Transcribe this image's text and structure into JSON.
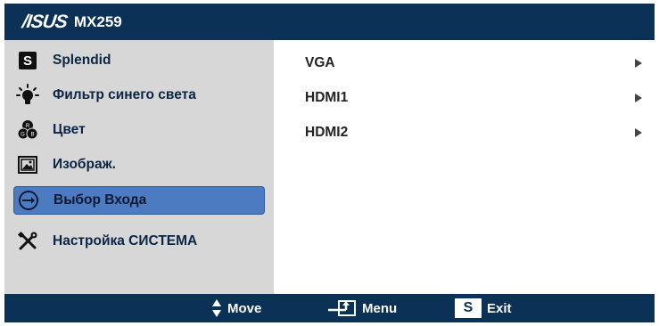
{
  "header": {
    "brand": "/ISUS",
    "model": "MX259"
  },
  "sidebar": {
    "items": [
      {
        "label": "Splendid",
        "icon": "splendid-s-icon"
      },
      {
        "label": "Фильтр синего света",
        "icon": "bulb-icon"
      },
      {
        "label": "Цвет",
        "icon": "rgb-icon"
      },
      {
        "label": "Изображ.",
        "icon": "image-icon"
      },
      {
        "label": "Выбор Входа",
        "icon": "input-select-icon",
        "selected": true
      },
      {
        "label": "Настройка СИСТЕМА",
        "icon": "tools-icon"
      }
    ]
  },
  "content": {
    "options": [
      {
        "label": "VGA"
      },
      {
        "label": "HDMI1"
      },
      {
        "label": "HDMI2"
      }
    ]
  },
  "footer": {
    "move_label": "Move",
    "menu_label": "Menu",
    "exit_label": "Exit",
    "exit_key": "S"
  },
  "colors": {
    "bar": "#0b3157",
    "sidebar": "#d7d7d7",
    "selected": "#4d7bc2"
  }
}
